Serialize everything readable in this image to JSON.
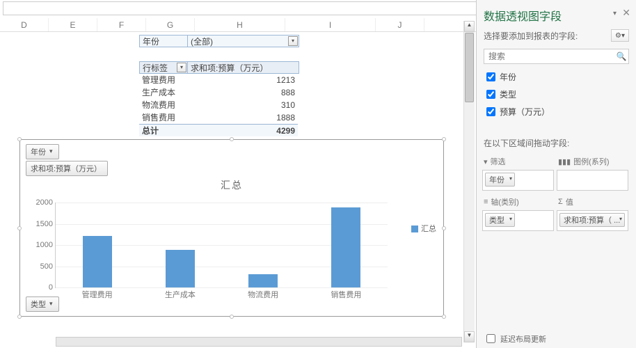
{
  "formula_bar": "",
  "columns": [
    "D",
    "E",
    "F",
    "G",
    "H",
    "I",
    "J"
  ],
  "pivot": {
    "page_field_label": "年份",
    "page_field_value": "(全部)",
    "row_header": "行标签",
    "val_header": "求和项:预算（万元）",
    "rows": [
      {
        "label": "管理费用",
        "value": "1213"
      },
      {
        "label": "生产成本",
        "value": "888"
      },
      {
        "label": "物流费用",
        "value": "310"
      },
      {
        "label": "销售费用",
        "value": "1888"
      }
    ],
    "total_label": "总计",
    "total_value": "4299"
  },
  "chart_buttons": {
    "year": "年份",
    "value": "求和项:预算（万元）",
    "type": "类型"
  },
  "chart_data": {
    "type": "bar",
    "title": "汇总",
    "categories": [
      "管理费用",
      "生产成本",
      "物流费用",
      "销售费用"
    ],
    "values": [
      1213,
      888,
      310,
      1888
    ],
    "ylim": [
      0,
      2000
    ],
    "yticks": [
      0,
      500,
      1000,
      1500,
      2000
    ],
    "legend": "汇总"
  },
  "panel": {
    "title": "数据透视图字段",
    "subtitle": "选择要添加到报表的字段:",
    "search_placeholder": "搜索",
    "fields": [
      {
        "label": "年份",
        "checked": true
      },
      {
        "label": "类型",
        "checked": true
      },
      {
        "label": "预算（万元）",
        "checked": true
      }
    ],
    "areas_title": "在以下区域间拖动字段:",
    "area_filter": "筛选",
    "area_legend": "图例(系列)",
    "area_axis": "轴(类别)",
    "area_values": "值",
    "pill_filter": "年份",
    "pill_axis": "类型",
    "pill_values": "求和项:预算（ ...",
    "defer_label": "延迟布局更新"
  }
}
